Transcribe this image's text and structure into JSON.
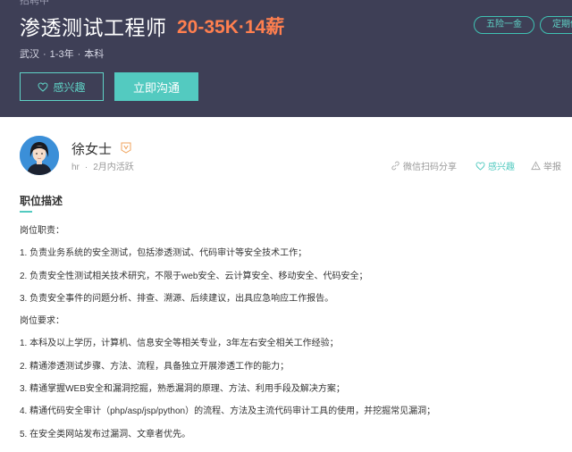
{
  "header": {
    "breadcrumb": "招聘中",
    "title": "渗透测试工程师",
    "salary": "20-35K·14薪",
    "meta": {
      "city": "武汉",
      "experience": "1-3年",
      "education": "本科"
    },
    "tags": [
      "五险一金",
      "定期体检"
    ],
    "interest_button": "感兴趣",
    "chat_button": "立即沟通"
  },
  "recruiter": {
    "name": "徐女士",
    "role": "hr",
    "active": "2月内活跃"
  },
  "actions": {
    "share": "微信扫码分享",
    "favorite": "感兴趣",
    "report": "举报"
  },
  "description": {
    "section_title": "职位描述",
    "lines": [
      "岗位职责：",
      "1. 负责业务系统的安全测试，包括渗透测试、代码审计等安全技术工作；",
      "2. 负责安全性测试相关技术研究，不限于web安全、云计算安全、移动安全、代码安全；",
      "3. 负责安全事件的问题分析、排查、溯源、后续建议，出具应急响应工作报告。",
      "岗位要求：",
      "1. 本科及以上学历，计算机、信息安全等相关专业，3年左右安全相关工作经验；",
      "2. 精通渗透测试步骤、方法、流程，具备独立开展渗透工作的能力；",
      "3. 精通掌握WEB安全和漏洞挖掘，熟悉漏洞的原理、方法、利用手段及解决方案；",
      "4. 精通代码安全审计（php/asp/jsp/python）的流程、方法及主流代码审计工具的使用，并挖掘常见漏洞；",
      "5. 在安全类网站发布过漏洞、文章者优先。"
    ]
  },
  "colors": {
    "header_bg": "#3e3f56",
    "salary": "#ff7f4f",
    "accent": "#53cac0"
  }
}
